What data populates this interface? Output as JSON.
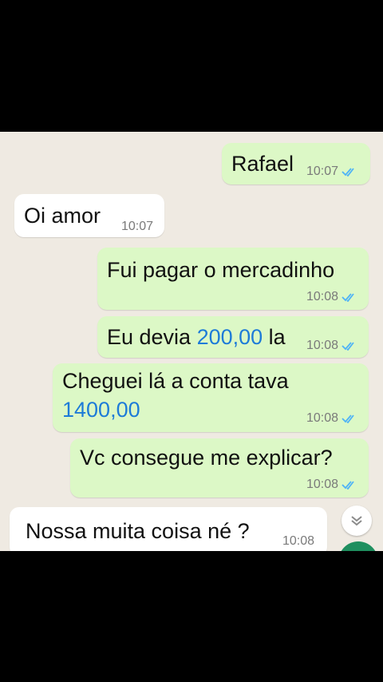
{
  "messages": [
    {
      "id": "m1",
      "direction": "out",
      "text": "Rafael",
      "time": "10:07",
      "read": true
    },
    {
      "id": "m2",
      "direction": "in",
      "text": "Oi amor",
      "time": "10:07"
    },
    {
      "id": "m3",
      "direction": "out",
      "text": "Fui pagar o mercadinho",
      "time": "10:08",
      "read": true
    },
    {
      "id": "m4",
      "direction": "out",
      "text_before": "Eu devia ",
      "amount": "200,00",
      "text_after": " la",
      "time": "10:08",
      "read": true
    },
    {
      "id": "m5",
      "direction": "out",
      "text": "Cheguei lá a conta tava",
      "amount": "1400,00",
      "time": "10:08",
      "read": true
    },
    {
      "id": "m6",
      "direction": "out",
      "text": "Vc consegue me explicar?",
      "time": "10:08",
      "read": true
    },
    {
      "id": "m7",
      "direction": "in",
      "text": "Nossa muita coisa né ?",
      "time": "10:08"
    }
  ],
  "colors": {
    "outgoing": "#dcf8c6",
    "incoming": "#ffffff",
    "read_ticks": "#4fb3f6",
    "link": "#1d7bd8",
    "accent": "#1f8f5f"
  },
  "icons": {
    "scroll_down": "double-chevron-down-icon",
    "read_receipt": "double-check-icon"
  }
}
